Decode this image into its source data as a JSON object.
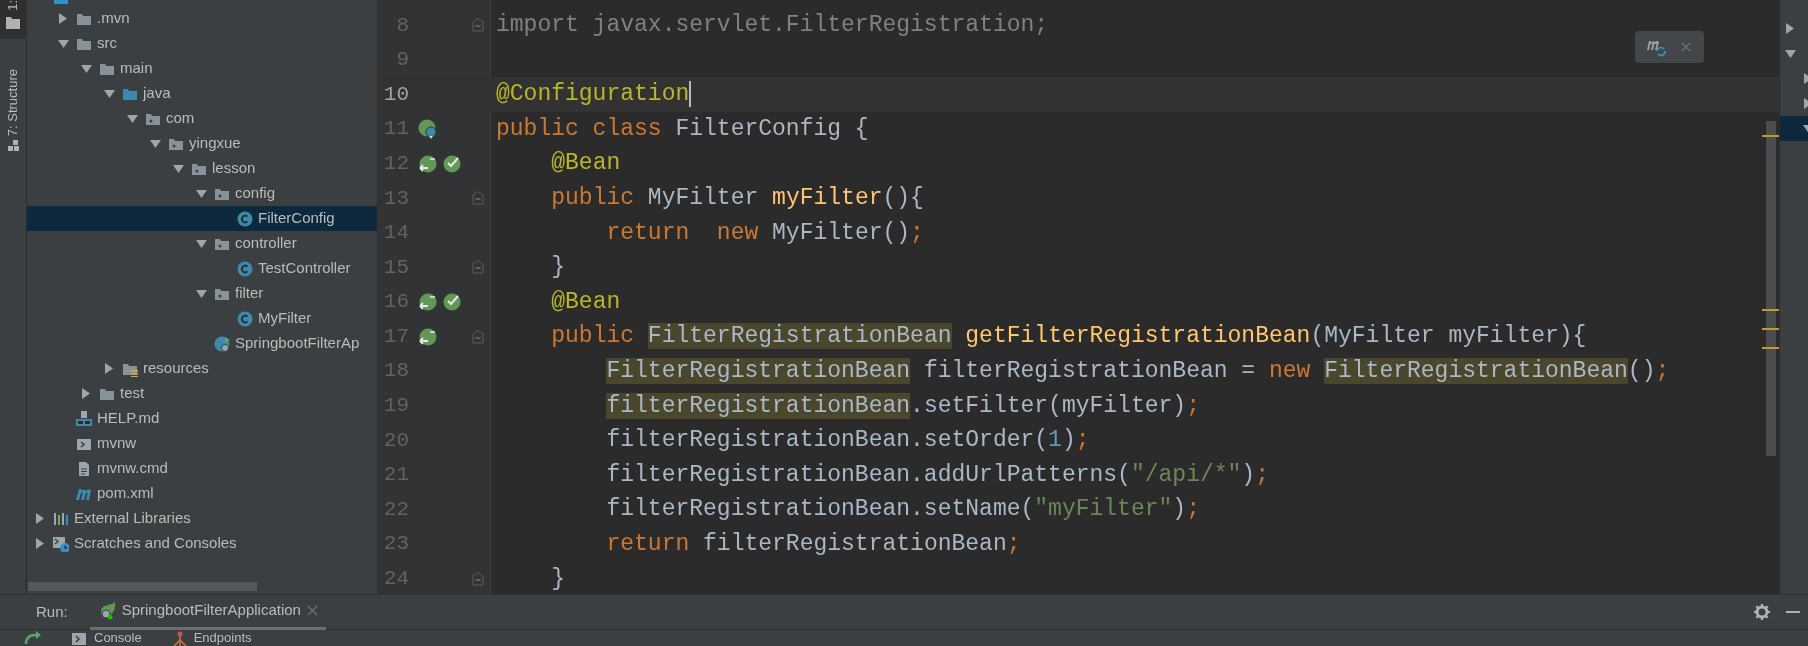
{
  "tool_strip": [
    {
      "label": "1:",
      "selected": true
    },
    {
      "label": "7: Structure",
      "selected": false
    }
  ],
  "project_tree": {
    "items": [
      {
        "kind": "project",
        "children": [
          {
            "label": ".mvn",
            "kind": "folder",
            "expanded": false,
            "selected": false
          },
          {
            "label": "src",
            "kind": "folder",
            "expanded": true,
            "selected": false,
            "children": [
              {
                "label": "main",
                "kind": "folder",
                "expanded": true,
                "selected": false,
                "children": [
                  {
                    "label": "java",
                    "kind": "source",
                    "expanded": true,
                    "selected": false,
                    "children": [
                      {
                        "label": "com",
                        "kind": "package",
                        "expanded": true,
                        "selected": false,
                        "children": [
                          {
                            "label": "yingxue",
                            "kind": "package",
                            "expanded": true,
                            "selected": false,
                            "children": [
                              {
                                "label": "lesson",
                                "kind": "package",
                                "expanded": true,
                                "selected": false,
                                "children": [
                                  {
                                    "label": "config",
                                    "kind": "package",
                                    "expanded": true,
                                    "selected": false,
                                    "children": [
                                      {
                                        "label": "FilterConfig",
                                        "kind": "class",
                                        "selected": true
                                      }
                                    ]
                                  },
                                  {
                                    "label": "controller",
                                    "kind": "package",
                                    "expanded": true,
                                    "selected": false,
                                    "children": [
                                      {
                                        "label": "TestController",
                                        "kind": "class",
                                        "selected": false
                                      }
                                    ]
                                  },
                                  {
                                    "label": "filter",
                                    "kind": "package",
                                    "expanded": true,
                                    "selected": false,
                                    "children": [
                                      {
                                        "label": "MyFilter",
                                        "kind": "class",
                                        "selected": false
                                      }
                                    ]
                                  },
                                  {
                                    "label": "SpringbootFilterAp",
                                    "kind": "spring",
                                    "selected": false
                                  }
                                ]
                              }
                            ]
                          }
                        ]
                      }
                    ]
                  },
                  {
                    "label": "resources",
                    "kind": "resources",
                    "expanded": false,
                    "selected": false
                  }
                ]
              },
              {
                "label": "test",
                "kind": "folder",
                "expanded": false,
                "selected": false
              }
            ]
          },
          {
            "label": "HELP.md",
            "kind": "markdown",
            "selected": false
          },
          {
            "label": "mvnw",
            "kind": "shell",
            "selected": false
          },
          {
            "label": "mvnw.cmd",
            "kind": "text",
            "selected": false
          },
          {
            "label": "pom.xml",
            "kind": "maven",
            "selected": false
          }
        ]
      },
      {
        "label": "External Libraries",
        "kind": "libraries",
        "expanded": false,
        "selected": false
      },
      {
        "label": "Scratches and Consoles",
        "kind": "scratches",
        "expanded": false,
        "selected": false
      }
    ]
  },
  "editor": {
    "lines": [
      {
        "number": "8",
        "current": false,
        "fold": true,
        "tokens": [
          {
            "kind": "unused",
            "text": "import javax.servlet.FilterRegistration;",
            "highlighted": false
          }
        ]
      },
      {
        "number": "9",
        "current": false,
        "fold": false
      },
      {
        "number": "10",
        "current": true,
        "fold": false,
        "tokens": [
          {
            "kind": "annotation",
            "text": "@Configuration",
            "highlighted": false
          }
        ]
      },
      {
        "number": "11",
        "current": false,
        "fold": false,
        "gutter": [
          {
            "kind": "class"
          }
        ],
        "tokens": [
          {
            "kind": "keyword",
            "text": "public class ",
            "highlighted": false
          },
          {
            "kind": "plain",
            "text": "FilterConfig {",
            "highlighted": false
          }
        ]
      },
      {
        "number": "12",
        "current": false,
        "fold": false,
        "gutter": [
          {
            "kind": "method"
          },
          {
            "kind": "check"
          }
        ],
        "tokens": [
          {
            "kind": "annotation",
            "text": "    @Bean",
            "highlighted": false
          }
        ]
      },
      {
        "number": "13",
        "current": false,
        "fold": true,
        "tokens": [
          {
            "kind": "keyword",
            "text": "    public ",
            "highlighted": false
          },
          {
            "kind": "plain",
            "text": "MyFilter ",
            "highlighted": false
          },
          {
            "kind": "method",
            "text": "myFilter",
            "highlighted": false
          },
          {
            "kind": "plain",
            "text": "(){",
            "highlighted": false
          }
        ]
      },
      {
        "number": "14",
        "current": false,
        "fold": false,
        "tokens": [
          {
            "kind": "keyword",
            "text": "        return  new ",
            "highlighted": false
          },
          {
            "kind": "plain",
            "text": "MyFilter()",
            "highlighted": false
          },
          {
            "kind": "keyword",
            "text": ";",
            "highlighted": false
          }
        ]
      },
      {
        "number": "15",
        "current": false,
        "fold": true,
        "tokens": [
          {
            "kind": "plain",
            "text": "    }",
            "highlighted": false
          }
        ]
      },
      {
        "number": "16",
        "current": false,
        "fold": false,
        "gutter": [
          {
            "kind": "method"
          },
          {
            "kind": "check"
          }
        ],
        "tokens": [
          {
            "kind": "annotation",
            "text": "    @Bean",
            "highlighted": false
          }
        ]
      },
      {
        "number": "17",
        "current": false,
        "fold": true,
        "gutter": [
          {
            "kind": "method"
          }
        ],
        "tokens": [
          {
            "kind": "keyword",
            "text": "    public ",
            "highlighted": false
          },
          {
            "kind": "plain",
            "text": "FilterRegistrationBean",
            "highlighted": true
          },
          {
            "kind": "method",
            "text": " getFilterRegistrationBean",
            "highlighted": false
          },
          {
            "kind": "plain",
            "text": "(MyFilter myFilter){",
            "highlighted": false
          }
        ]
      },
      {
        "number": "18",
        "current": false,
        "fold": false,
        "tokens": [
          {
            "kind": "plain",
            "text": "        FilterRegistrationBean",
            "highlighted": true
          },
          {
            "kind": "plain",
            "text": " filterRegistrationBean = ",
            "highlighted": false
          },
          {
            "kind": "keyword",
            "text": "new ",
            "highlighted": false
          },
          {
            "kind": "plain",
            "text": "FilterRegistrationBean",
            "highlighted": true
          },
          {
            "kind": "plain",
            "text": "()",
            "highlighted": false
          },
          {
            "kind": "keyword",
            "text": ";",
            "highlighted": false
          }
        ]
      },
      {
        "number": "19",
        "current": false,
        "fold": false,
        "tokens": [
          {
            "kind": "plain",
            "text": "        filterRegistrationBean",
            "highlighted": true
          },
          {
            "kind": "plain",
            "text": ".setFilter(myFilter)",
            "highlighted": false
          },
          {
            "kind": "keyword",
            "text": ";",
            "highlighted": false
          }
        ]
      },
      {
        "number": "20",
        "current": false,
        "fold": false,
        "tokens": [
          {
            "kind": "plain",
            "text": "        filterRegistrationBean.setOrder(",
            "highlighted": false
          },
          {
            "kind": "number",
            "text": "1",
            "highlighted": false
          },
          {
            "kind": "plain",
            "text": ")",
            "highlighted": false
          },
          {
            "kind": "keyword",
            "text": ";",
            "highlighted": false
          }
        ]
      },
      {
        "number": "21",
        "current": false,
        "fold": false,
        "tokens": [
          {
            "kind": "plain",
            "text": "        filterRegistrationBean.addUrlPatterns(",
            "highlighted": false
          },
          {
            "kind": "string",
            "text": "\"/api/*\"",
            "highlighted": false
          },
          {
            "kind": "plain",
            "text": ")",
            "highlighted": false
          },
          {
            "kind": "keyword",
            "text": ";",
            "highlighted": false
          }
        ]
      },
      {
        "number": "22",
        "current": false,
        "fold": false,
        "tokens": [
          {
            "kind": "plain",
            "text": "        filterRegistrationBean.setName(",
            "highlighted": false
          },
          {
            "kind": "string",
            "text": "\"myFilter\"",
            "highlighted": false
          },
          {
            "kind": "plain",
            "text": ")",
            "highlighted": false
          },
          {
            "kind": "keyword",
            "text": ";",
            "highlighted": false
          }
        ]
      },
      {
        "number": "23",
        "current": false,
        "fold": false,
        "tokens": [
          {
            "kind": "keyword",
            "text": "        return ",
            "highlighted": false
          },
          {
            "kind": "plain",
            "text": "filterRegistrationBean",
            "highlighted": false
          },
          {
            "kind": "keyword",
            "text": ";",
            "highlighted": false
          }
        ]
      },
      {
        "number": "24",
        "current": false,
        "fold": true,
        "tokens": [
          {
            "kind": "plain",
            "text": "    }",
            "highlighted": false
          }
        ]
      }
    ]
  },
  "side_panel": {
    "items": [
      {
        "expanded": false,
        "selected": false
      },
      {
        "expanded": true,
        "selected": false
      },
      {
        "expanded": false,
        "selected": false
      },
      {
        "expanded": false,
        "selected": false
      },
      {
        "expanded": true,
        "selected": true
      }
    ]
  },
  "run_panel": {
    "label": "Run:",
    "tabs": [
      {
        "label": "SpringbootFilterApplication",
        "selected": true
      }
    ],
    "toolbar_tabs": [
      {
        "label": "Console",
        "kind": "console"
      },
      {
        "label": "Endpoints",
        "kind": "endpoints"
      }
    ]
  }
}
